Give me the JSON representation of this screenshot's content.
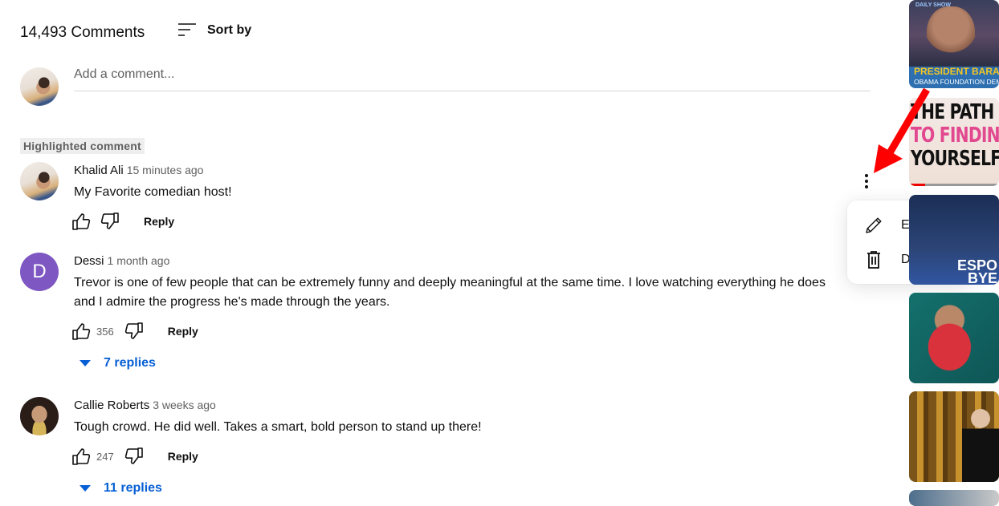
{
  "header": {
    "comment_count": "14,493 Comments",
    "sort_label": "Sort by"
  },
  "add_comment": {
    "placeholder": "Add a comment..."
  },
  "highlighted_label": "Highlighted comment",
  "comments": [
    {
      "author": "Khalid Ali",
      "time": "15 minutes ago",
      "text": "My Favorite comedian host!",
      "likes": "",
      "reply_label": "Reply",
      "highlighted": true
    },
    {
      "author": "Dessi",
      "avatar_letter": "D",
      "avatar_color": "#7e57c2",
      "time": "1 month ago",
      "text": "Trevor is one of few people that can be extremely funny and deeply meaningful at the same time. I love watching everything he does and I admire the progress he's made through the years.",
      "likes": "356",
      "reply_label": "Reply",
      "replies_label": "7 replies"
    },
    {
      "author": "Callie Roberts",
      "time": "3 weeks ago",
      "text": "Tough crowd. He did well. Takes a smart, bold person to stand up there!",
      "likes": "247",
      "reply_label": "Reply",
      "replies_label": "11 replies"
    }
  ],
  "context_menu": {
    "items": [
      {
        "label": "Edit",
        "icon": "pencil-icon"
      },
      {
        "label": "Delete",
        "icon": "trash-icon"
      }
    ]
  },
  "sidebar_thumbnails": [
    {
      "caption_line1": "PRESIDENT BARAC",
      "caption_line2": "OBAMA FOUNDATION DEMOC",
      "logo": "DAILY SHOW"
    },
    {
      "line1": "THE PATH",
      "line2": "TO FINDING",
      "line3": "YOURSELF"
    },
    {
      "line1": "ESPO",
      "line2": "BYE"
    },
    {},
    {},
    {}
  ],
  "colors": {
    "link_blue": "#065fd4",
    "annotation_arrow": "#ff0000",
    "secondary_text": "#606060"
  }
}
